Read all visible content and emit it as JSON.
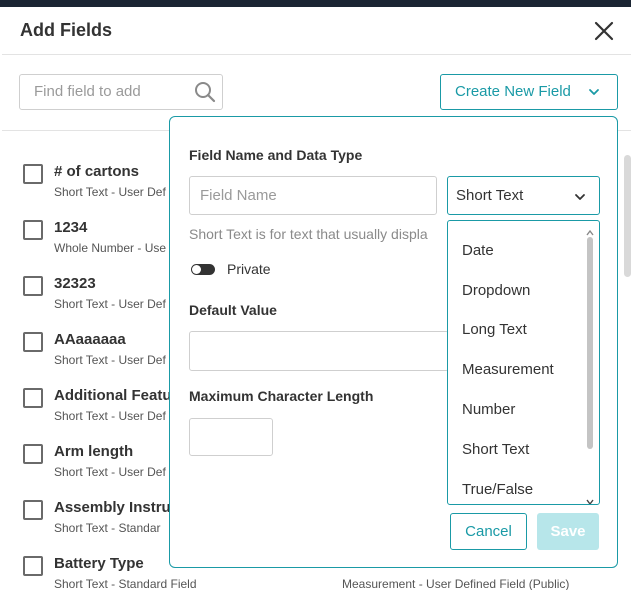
{
  "dialog": {
    "title": "Add Fields",
    "close_icon": "close-icon"
  },
  "toolbar": {
    "search_placeholder": "Find field to add",
    "search_value": "",
    "search_icon": "search-icon",
    "create_label": "Create New Field",
    "create_icon": "chevron-down-icon"
  },
  "fields": [
    {
      "name": "# of cartons",
      "sub": "Short Text - User Def",
      "right": ""
    },
    {
      "name": "1234",
      "sub": "Whole Number - Use",
      "right": ""
    },
    {
      "name": "32323",
      "sub": "Short Text - User Def",
      "right": ""
    },
    {
      "name": "AAaaaaaa",
      "sub": "Short Text - User Def",
      "right": ""
    },
    {
      "name": "Additional Featur",
      "sub": "Short Text - User Def",
      "right": ""
    },
    {
      "name": "Arm length",
      "sub": "Short Text - User Def",
      "right": ""
    },
    {
      "name": "Assembly Instruc",
      "sub": "Short Text - Standar",
      "right": ""
    },
    {
      "name": "Battery Type",
      "sub": "Short Text - Standard Field",
      "right": "Measurement - User Defined Field (Public)"
    }
  ],
  "new_field": {
    "section_title": "Field Name and Data Type",
    "name_placeholder": "Field Name",
    "name_value": "",
    "type_value": "Short Text",
    "type_description": "Short Text is for text that usually displa",
    "private_label": "Private",
    "private_on": false,
    "default_value_label": "Default Value",
    "default_value": "",
    "max_length_label": "Maximum Character Length",
    "max_length": "",
    "cancel_label": "Cancel",
    "save_label": "Save"
  },
  "type_options": [
    "Date",
    "Dropdown",
    "Long Text",
    "Measurement",
    "Number",
    "Short Text",
    "True/False"
  ],
  "colors": {
    "accent": "#1a9aa6",
    "save_disabled": "#b7e6ea",
    "top_strip": "#1b2533"
  }
}
